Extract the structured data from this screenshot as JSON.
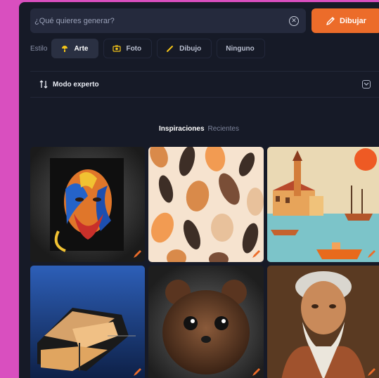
{
  "search": {
    "placeholder": "¿Qué quieres generar?",
    "value": ""
  },
  "draw_button": {
    "label": "Dibujar"
  },
  "style": {
    "label": "Estilo",
    "chips": [
      {
        "label": "Arte",
        "icon": "paint-icon",
        "selected": true
      },
      {
        "label": "Foto",
        "icon": "camera-icon",
        "selected": false
      },
      {
        "label": "Dibujo",
        "icon": "pencil-icon",
        "selected": false
      },
      {
        "label": "Ninguno",
        "icon": "",
        "selected": false
      }
    ]
  },
  "expert_mode": {
    "label": "Modo experto",
    "icon": "sliders-icon",
    "toggle_icon": "chevron-down-icon"
  },
  "tabs": [
    {
      "label": "Inspiraciones",
      "active": true
    },
    {
      "label": "Recientes",
      "active": false
    }
  ],
  "gallery": [
    {
      "subject": "colorful-portrait-artwork",
      "edit_icon": "brush-edit-icon"
    },
    {
      "subject": "seed-pattern",
      "edit_icon": "brush-edit-icon"
    },
    {
      "subject": "harbor-town-painting",
      "edit_icon": "brush-edit-icon"
    },
    {
      "subject": "modern-house-night",
      "edit_icon": "brush-edit-icon"
    },
    {
      "subject": "fluffy-brown-creature",
      "edit_icon": "brush-edit-icon"
    },
    {
      "subject": "old-man-portrait",
      "edit_icon": "brush-edit-icon"
    }
  ],
  "colors": {
    "accent": "#ec6c2a",
    "background": "#161a27",
    "outer": "#d94fbf"
  }
}
